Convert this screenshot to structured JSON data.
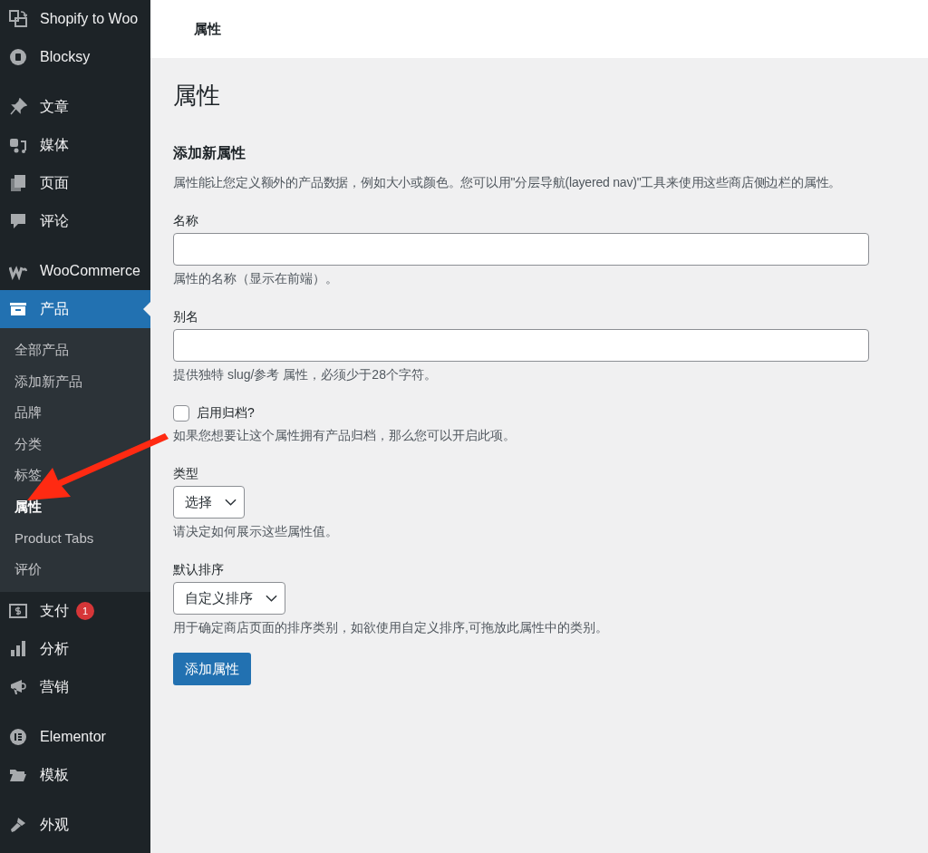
{
  "top_bar": {
    "title": "属性"
  },
  "sidebar": {
    "groups": [
      [
        {
          "label": "Shopify to Woo",
          "selected": false
        },
        {
          "label": "Blocksy",
          "selected": false
        }
      ],
      [
        {
          "label": "文章",
          "selected": false
        },
        {
          "label": "媒体",
          "selected": false
        },
        {
          "label": "页面",
          "selected": false
        },
        {
          "label": "评论",
          "selected": false
        }
      ],
      [
        {
          "label": "WooCommerce",
          "selected": false
        },
        {
          "label": "产品",
          "selected": true,
          "children": [
            {
              "label": "全部产品",
              "selected": false
            },
            {
              "label": "添加新产品",
              "selected": false
            },
            {
              "label": "品牌",
              "selected": false
            },
            {
              "label": "分类",
              "selected": false
            },
            {
              "label": "标签",
              "selected": false
            },
            {
              "label": "属性",
              "selected": true
            },
            {
              "label": "Product Tabs",
              "selected": false
            },
            {
              "label": "评价",
              "selected": false
            }
          ]
        },
        {
          "label": "支付",
          "selected": false,
          "badge": "1"
        },
        {
          "label": "分析",
          "selected": false
        },
        {
          "label": "营销",
          "selected": false
        }
      ],
      [
        {
          "label": "Elementor",
          "selected": false
        },
        {
          "label": "模板",
          "selected": false
        }
      ],
      [
        {
          "label": "外观",
          "selected": false
        }
      ]
    ]
  },
  "page_title": "属性",
  "form": {
    "title": "添加新属性",
    "description": "属性能让您定义额外的产品数据，例如大小或颜色。您可以用\"分层导航(layered nav)\"工具来使用这些商店侧边栏的属性。",
    "fields": [
      {
        "kind": "text",
        "label": "名称",
        "helper": "属性的名称（显示在前端）。"
      },
      {
        "kind": "text",
        "label": "别名",
        "helper": "提供独特 slug/参考 属性，必须少于28个字符。"
      },
      {
        "kind": "checkbox",
        "label": "启用归档?",
        "checked": false,
        "helper": "如果您想要让这个属性拥有产品归档，那么您可以开启此项。"
      },
      {
        "kind": "select",
        "label": "类型",
        "value": "选择",
        "helper": "请决定如何展示这些属性值。"
      },
      {
        "kind": "select",
        "label": "默认排序",
        "value": "自定义排序",
        "helper": "用于确定商店页面的排序类别，如欲使用自定义排序,可拖放此属性中的类别。"
      }
    ],
    "submit_button": "添加属性"
  }
}
